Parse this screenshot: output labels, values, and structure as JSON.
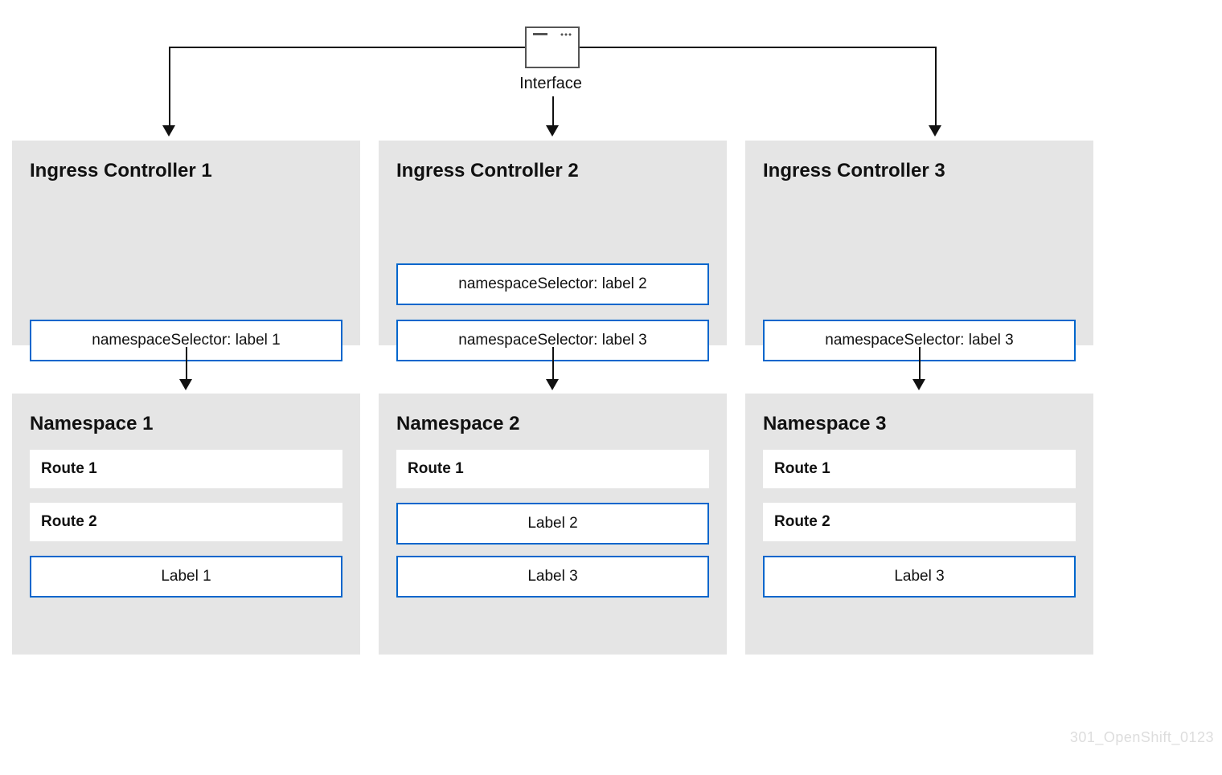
{
  "interface": {
    "label": "Interface"
  },
  "controllers": [
    {
      "title": "Ingress Controller 1",
      "selectors": [
        "namespaceSelector: label 1"
      ]
    },
    {
      "title": "Ingress Controller 2",
      "selectors": [
        "namespaceSelector: label 2",
        "namespaceSelector: label 3"
      ]
    },
    {
      "title": "Ingress Controller 3",
      "selectors": [
        "namespaceSelector: label 3"
      ]
    }
  ],
  "namespaces": [
    {
      "title": "Namespace 1",
      "routes": [
        "Route 1",
        "Route 2"
      ],
      "labels": [
        "Label 1"
      ]
    },
    {
      "title": "Namespace 2",
      "routes": [
        "Route 1"
      ],
      "labels": [
        "Label 2",
        "Label 3"
      ]
    },
    {
      "title": "Namespace 3",
      "routes": [
        "Route 1",
        "Route 2"
      ],
      "labels": [
        "Label 3"
      ]
    }
  ],
  "watermark": "301_OpenShift_0123"
}
